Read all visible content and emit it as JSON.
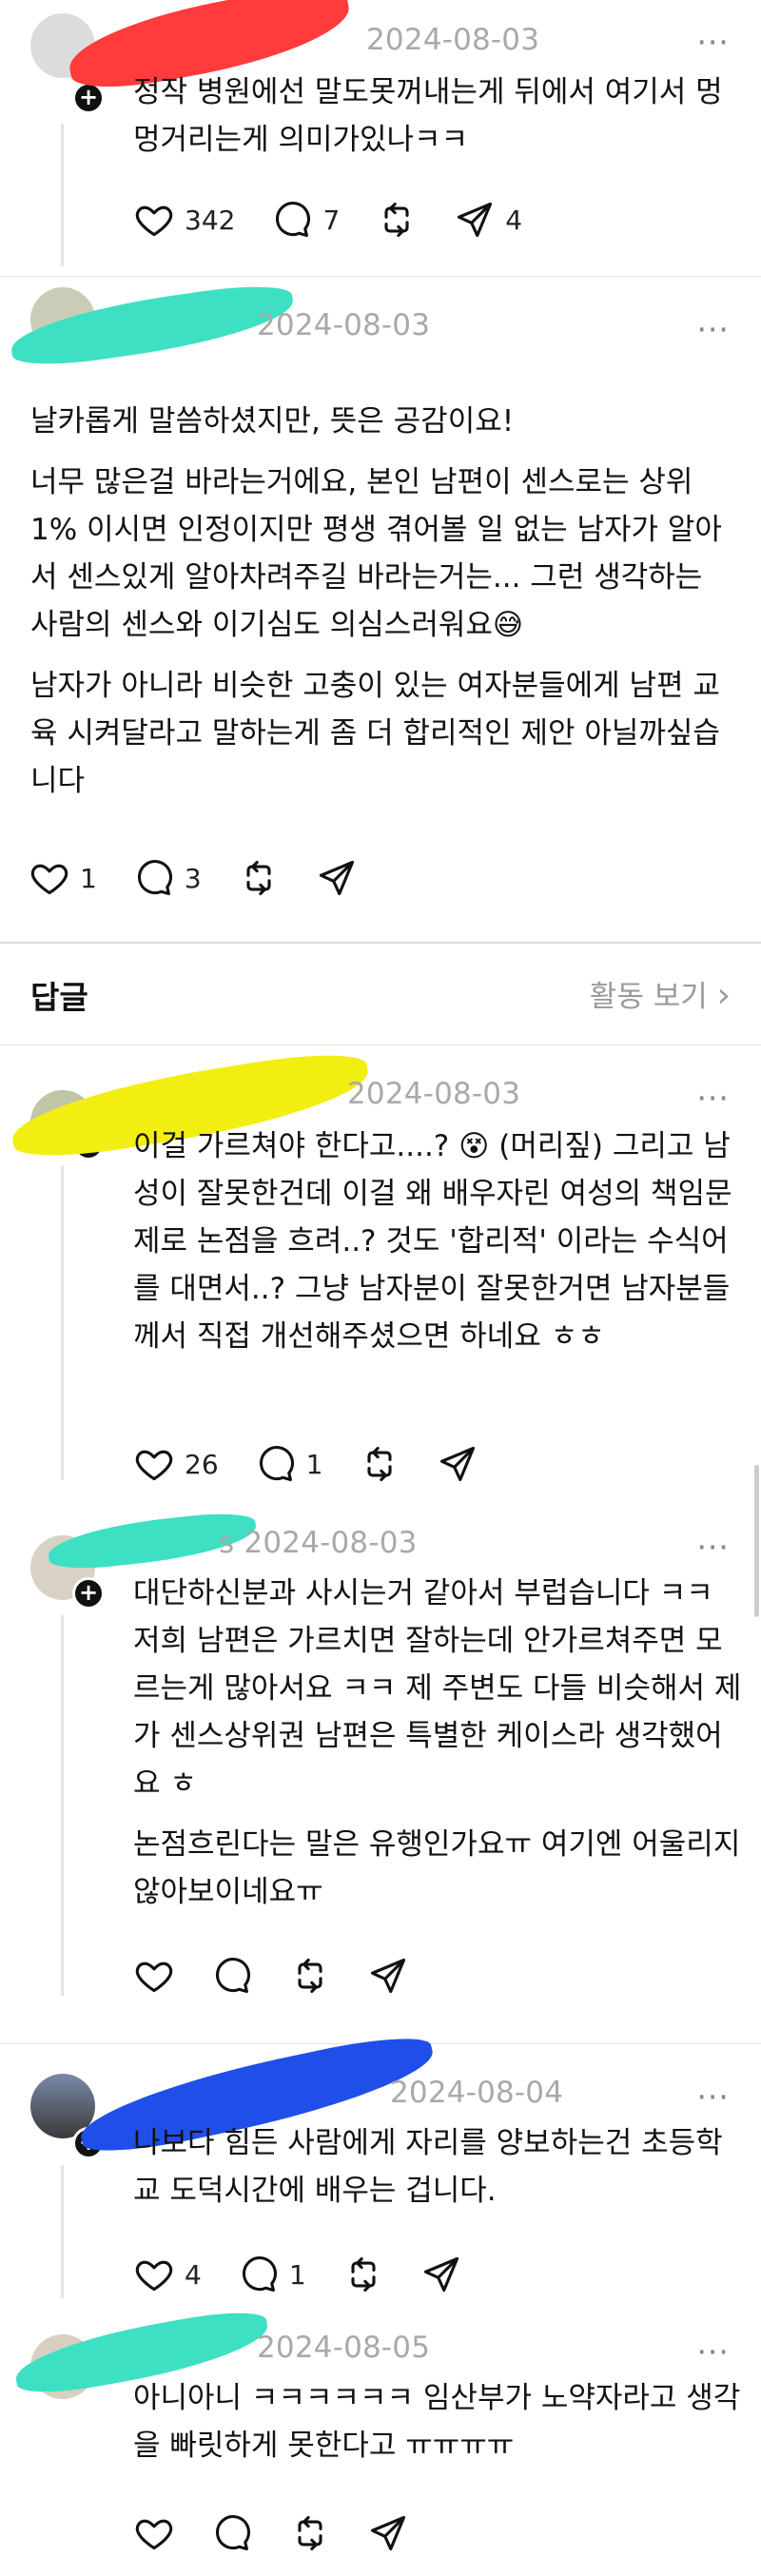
{
  "posts": [
    {
      "date": "2024-08-03",
      "paragraphs": [
        "정작 병원에선 말도못꺼내는게 뒤에서 여기서 멍멍거리는게 의미가있나ㅋㅋ"
      ],
      "likes": "342",
      "comments": "7",
      "reposts": "",
      "shares": "4"
    },
    {
      "date": "2024-08-03",
      "paragraphs": [
        "날카롭게 말씀하셨지만, 뜻은 공감이요!",
        "너무 많은걸 바라는거에요, 본인 남편이 센스로는 상위 1% 이시면 인정이지만 평생 겪어볼 일 없는 남자가 알아서 센스있게 알아차려주길 바라는거는... 그런 생각하는 사람의 센스와 이기심도 의심스러워요😅",
        "남자가 아니라 비슷한 고충이 있는 여자분들에게 남편 교육 시켜달라고 말하는게 좀 더 합리적인 제안 아닐까싶습니다"
      ],
      "likes": "1",
      "comments": "3",
      "reposts": "",
      "shares": ""
    },
    {
      "date": "2024-08-03",
      "paragraphs": [
        "이걸 가르쳐야 한다고....? 😵 (머리짚) 그리고 남성이 잘못한건데 이걸 왜 배우자린 여성의 책임문제로 논점을 흐려..? 것도 '합리적' 이라는 수식어를 대면서..? 그냥 남자분이 잘못한거면 남자분들께서 직접 개선해주셨으면 하네요 ㅎㅎ"
      ],
      "likes": "26",
      "comments": "1",
      "reposts": "",
      "shares": ""
    },
    {
      "date": "2024-08-03",
      "name_tail": "s",
      "paragraphs": [
        "대단하신분과 사시는거 같아서 부럽습니다 ㅋㅋ 저희 남편은 가르치면 잘하는데 안가르쳐주면 모르는게 많아서요 ㅋㅋ 제 주변도 다들 비슷해서 제가 센스상위권 남편은 특별한 케이스라 생각했어요 ㅎ",
        "논점흐린다는 말은 유행인가요ㅠ 여기엔 어울리지 않아보이네요ㅠ"
      ],
      "likes": "",
      "comments": "",
      "reposts": "",
      "shares": ""
    },
    {
      "date": "2024-08-04",
      "paragraphs": [
        "나보다 힘든 사람에게 자리를 양보하는건 초등학교 도덕시간에 배우는 겁니다."
      ],
      "likes": "4",
      "comments": "1",
      "reposts": "",
      "shares": ""
    },
    {
      "date": "2024-08-05",
      "paragraphs": [
        "아니아니 ㅋㅋㅋㅋㅋㅋ 임산부가 노약자라고 생각을 빠릿하게 못한다고 ㅠㅠㅠㅠ"
      ],
      "likes": "",
      "comments": "",
      "reposts": "",
      "shares": ""
    }
  ],
  "replies": {
    "title": "답글",
    "activity": "활동 보기",
    "chevron": "›"
  },
  "icons": {
    "more": "⋯",
    "plus": "+",
    "like": "heart-icon",
    "comment": "comment-icon",
    "repost": "repost-icon",
    "share": "send-icon"
  },
  "colors": {
    "censor_red": "#ff3b3b",
    "censor_teal": "#3ee0c4",
    "censor_yellow": "#f2ee12",
    "censor_blue": "#1f4fe8"
  }
}
